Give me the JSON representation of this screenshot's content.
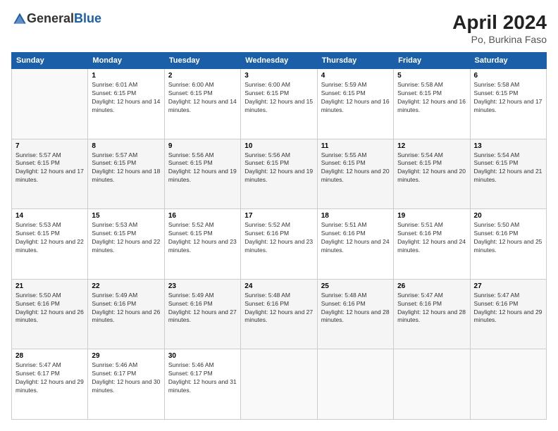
{
  "logo": {
    "general": "General",
    "blue": "Blue"
  },
  "header": {
    "month": "April 2024",
    "location": "Po, Burkina Faso"
  },
  "weekdays": [
    "Sunday",
    "Monday",
    "Tuesday",
    "Wednesday",
    "Thursday",
    "Friday",
    "Saturday"
  ],
  "weeks": [
    [
      {
        "day": "",
        "sunrise": "",
        "sunset": "",
        "daylight": ""
      },
      {
        "day": "1",
        "sunrise": "Sunrise: 6:01 AM",
        "sunset": "Sunset: 6:15 PM",
        "daylight": "Daylight: 12 hours and 14 minutes."
      },
      {
        "day": "2",
        "sunrise": "Sunrise: 6:00 AM",
        "sunset": "Sunset: 6:15 PM",
        "daylight": "Daylight: 12 hours and 14 minutes."
      },
      {
        "day": "3",
        "sunrise": "Sunrise: 6:00 AM",
        "sunset": "Sunset: 6:15 PM",
        "daylight": "Daylight: 12 hours and 15 minutes."
      },
      {
        "day": "4",
        "sunrise": "Sunrise: 5:59 AM",
        "sunset": "Sunset: 6:15 PM",
        "daylight": "Daylight: 12 hours and 16 minutes."
      },
      {
        "day": "5",
        "sunrise": "Sunrise: 5:58 AM",
        "sunset": "Sunset: 6:15 PM",
        "daylight": "Daylight: 12 hours and 16 minutes."
      },
      {
        "day": "6",
        "sunrise": "Sunrise: 5:58 AM",
        "sunset": "Sunset: 6:15 PM",
        "daylight": "Daylight: 12 hours and 17 minutes."
      }
    ],
    [
      {
        "day": "7",
        "sunrise": "Sunrise: 5:57 AM",
        "sunset": "Sunset: 6:15 PM",
        "daylight": "Daylight: 12 hours and 17 minutes."
      },
      {
        "day": "8",
        "sunrise": "Sunrise: 5:57 AM",
        "sunset": "Sunset: 6:15 PM",
        "daylight": "Daylight: 12 hours and 18 minutes."
      },
      {
        "day": "9",
        "sunrise": "Sunrise: 5:56 AM",
        "sunset": "Sunset: 6:15 PM",
        "daylight": "Daylight: 12 hours and 19 minutes."
      },
      {
        "day": "10",
        "sunrise": "Sunrise: 5:56 AM",
        "sunset": "Sunset: 6:15 PM",
        "daylight": "Daylight: 12 hours and 19 minutes."
      },
      {
        "day": "11",
        "sunrise": "Sunrise: 5:55 AM",
        "sunset": "Sunset: 6:15 PM",
        "daylight": "Daylight: 12 hours and 20 minutes."
      },
      {
        "day": "12",
        "sunrise": "Sunrise: 5:54 AM",
        "sunset": "Sunset: 6:15 PM",
        "daylight": "Daylight: 12 hours and 20 minutes."
      },
      {
        "day": "13",
        "sunrise": "Sunrise: 5:54 AM",
        "sunset": "Sunset: 6:15 PM",
        "daylight": "Daylight: 12 hours and 21 minutes."
      }
    ],
    [
      {
        "day": "14",
        "sunrise": "Sunrise: 5:53 AM",
        "sunset": "Sunset: 6:15 PM",
        "daylight": "Daylight: 12 hours and 22 minutes."
      },
      {
        "day": "15",
        "sunrise": "Sunrise: 5:53 AM",
        "sunset": "Sunset: 6:15 PM",
        "daylight": "Daylight: 12 hours and 22 minutes."
      },
      {
        "day": "16",
        "sunrise": "Sunrise: 5:52 AM",
        "sunset": "Sunset: 6:15 PM",
        "daylight": "Daylight: 12 hours and 23 minutes."
      },
      {
        "day": "17",
        "sunrise": "Sunrise: 5:52 AM",
        "sunset": "Sunset: 6:16 PM",
        "daylight": "Daylight: 12 hours and 23 minutes."
      },
      {
        "day": "18",
        "sunrise": "Sunrise: 5:51 AM",
        "sunset": "Sunset: 6:16 PM",
        "daylight": "Daylight: 12 hours and 24 minutes."
      },
      {
        "day": "19",
        "sunrise": "Sunrise: 5:51 AM",
        "sunset": "Sunset: 6:16 PM",
        "daylight": "Daylight: 12 hours and 24 minutes."
      },
      {
        "day": "20",
        "sunrise": "Sunrise: 5:50 AM",
        "sunset": "Sunset: 6:16 PM",
        "daylight": "Daylight: 12 hours and 25 minutes."
      }
    ],
    [
      {
        "day": "21",
        "sunrise": "Sunrise: 5:50 AM",
        "sunset": "Sunset: 6:16 PM",
        "daylight": "Daylight: 12 hours and 26 minutes."
      },
      {
        "day": "22",
        "sunrise": "Sunrise: 5:49 AM",
        "sunset": "Sunset: 6:16 PM",
        "daylight": "Daylight: 12 hours and 26 minutes."
      },
      {
        "day": "23",
        "sunrise": "Sunrise: 5:49 AM",
        "sunset": "Sunset: 6:16 PM",
        "daylight": "Daylight: 12 hours and 27 minutes."
      },
      {
        "day": "24",
        "sunrise": "Sunrise: 5:48 AM",
        "sunset": "Sunset: 6:16 PM",
        "daylight": "Daylight: 12 hours and 27 minutes."
      },
      {
        "day": "25",
        "sunrise": "Sunrise: 5:48 AM",
        "sunset": "Sunset: 6:16 PM",
        "daylight": "Daylight: 12 hours and 28 minutes."
      },
      {
        "day": "26",
        "sunrise": "Sunrise: 5:47 AM",
        "sunset": "Sunset: 6:16 PM",
        "daylight": "Daylight: 12 hours and 28 minutes."
      },
      {
        "day": "27",
        "sunrise": "Sunrise: 5:47 AM",
        "sunset": "Sunset: 6:16 PM",
        "daylight": "Daylight: 12 hours and 29 minutes."
      }
    ],
    [
      {
        "day": "28",
        "sunrise": "Sunrise: 5:47 AM",
        "sunset": "Sunset: 6:17 PM",
        "daylight": "Daylight: 12 hours and 29 minutes."
      },
      {
        "day": "29",
        "sunrise": "Sunrise: 5:46 AM",
        "sunset": "Sunset: 6:17 PM",
        "daylight": "Daylight: 12 hours and 30 minutes."
      },
      {
        "day": "30",
        "sunrise": "Sunrise: 5:46 AM",
        "sunset": "Sunset: 6:17 PM",
        "daylight": "Daylight: 12 hours and 31 minutes."
      },
      {
        "day": "",
        "sunrise": "",
        "sunset": "",
        "daylight": ""
      },
      {
        "day": "",
        "sunrise": "",
        "sunset": "",
        "daylight": ""
      },
      {
        "day": "",
        "sunrise": "",
        "sunset": "",
        "daylight": ""
      },
      {
        "day": "",
        "sunrise": "",
        "sunset": "",
        "daylight": ""
      }
    ]
  ]
}
